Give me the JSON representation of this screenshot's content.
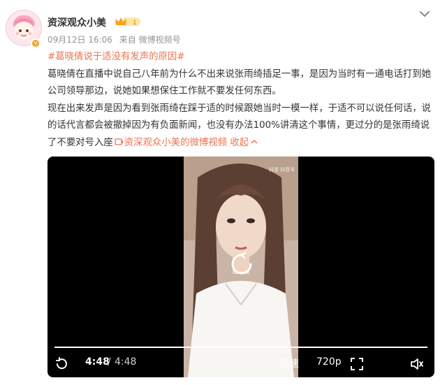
{
  "post": {
    "author": "资深观众小美",
    "time": "09月12日 16:06",
    "source": "来自 微博视频号",
    "hashtag": "#葛晓倩说于适没有发声的原因#",
    "paragraph1": "葛晓倩在直播中说自己八年前为什么不出来说张雨绮插足一事，是因为当时有一通电话打到她公司领导那边，说她如果想保住工作就不要发任何东西。",
    "paragraph2": "现在出来发声是因为看到张雨绮在踩于适的时候跟她当时一模一样，于适不可以说任何话，说的话代言都会被撤掉因为有负面新闻，也没有办法100%讲清这个事情，更过分的是张雨绮说了不要对号入座",
    "video_link": "资深观众小美的微博视频",
    "collapse": "收起"
  },
  "video": {
    "watermark": "抖音  抖音号",
    "current_time": "4:48",
    "separator": "/",
    "duration": "4:48",
    "speed_label": "倍速",
    "quality_label": "720p",
    "progress": 1.0
  },
  "colors": {
    "accent": "#eb7350",
    "meta": "#939393",
    "vip": "#f7a21d"
  },
  "icons": [
    "more-chevron-icon",
    "vip-crown-icon",
    "video-link-icon",
    "chevron-up-icon",
    "replay-icon",
    "loading-icon",
    "fullscreen-icon",
    "volume-icon"
  ]
}
